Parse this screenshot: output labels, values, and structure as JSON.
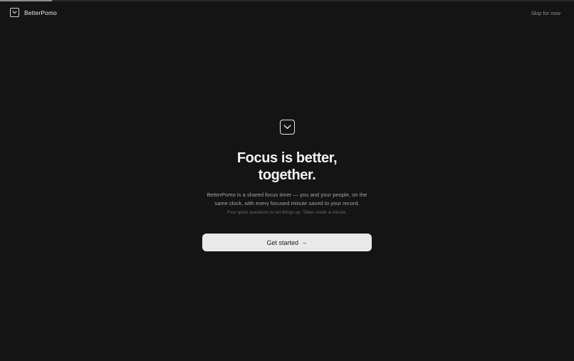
{
  "progress": {
    "value": 0.09
  },
  "header": {
    "brand_name": "BetterPomo",
    "brand_icon": "chevron-box-icon",
    "skip_label": "Skip for now"
  },
  "hero": {
    "icon": "chevron-box-icon",
    "headline_line1": "Focus is better,",
    "headline_line2": "together.",
    "description": "BetterPomo is a shared focus timer — you and your people, on the same clock, with every focused minute saved to your record.",
    "note": "Four quick questions to set things up. Takes under a minute."
  },
  "cta": {
    "label": "Get started",
    "arrow": "→"
  },
  "colors": {
    "background": "#141415",
    "button_bg": "#e9e9ea",
    "text_primary": "#f2f2f3",
    "text_secondary": "#a4a4a8",
    "text_muted": "#6a6a6e"
  }
}
